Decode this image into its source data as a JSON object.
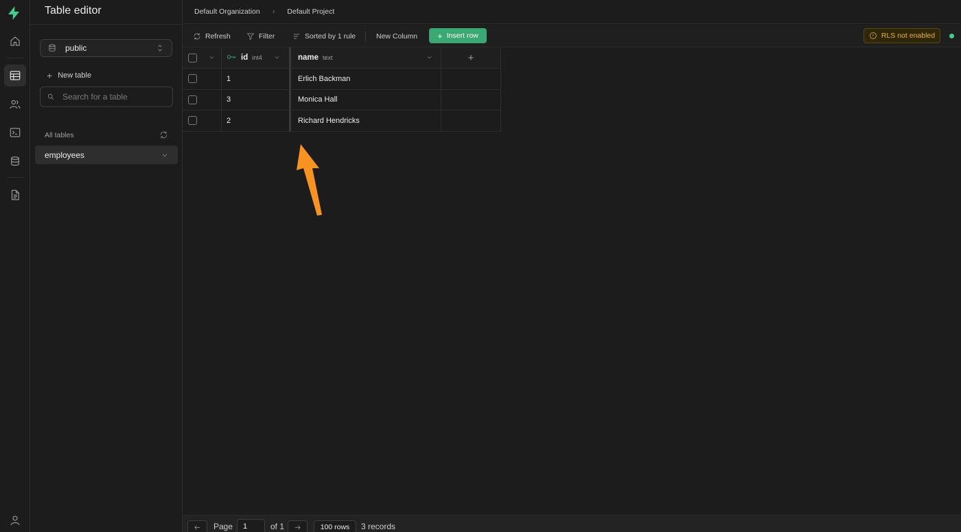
{
  "sidebar": {
    "title": "Table editor",
    "schema": "public",
    "new_table_label": "New table",
    "search_placeholder": "Search for a table",
    "all_tables_label": "All tables",
    "tables": [
      {
        "label": "employees"
      }
    ]
  },
  "breadcrumb": {
    "organization": "Default Organization",
    "project": "Default Project",
    "separator": "›"
  },
  "toolbar": {
    "refresh": "Refresh",
    "filter": "Filter",
    "sort": "Sorted by 1 rule",
    "new_column": "New Column",
    "insert_row": "Insert row",
    "rls": "RLS not enabled"
  },
  "grid": {
    "columns": [
      {
        "name": "id",
        "type": "int4",
        "primary_key": true
      },
      {
        "name": "name",
        "type": "text"
      }
    ],
    "add_column": "+",
    "rows": [
      {
        "id": "1",
        "name": "Erlich Backman"
      },
      {
        "id": "3",
        "name": "Monica Hall"
      },
      {
        "id": "2",
        "name": "Richard Hendricks"
      }
    ]
  },
  "footer": {
    "page_label": "Page",
    "page_value": "1",
    "of_label": "of 1",
    "rows_per_page": "100 rows",
    "records": "3 records"
  },
  "colors": {
    "brand": "#3ecf8e",
    "annotation_arrow": "#f7931e",
    "warning": "#e7b22c"
  },
  "icons": [
    "supabase-logo-icon",
    "home-icon",
    "table-editor-icon",
    "auth-users-icon",
    "sql-editor-icon",
    "database-icon",
    "docs-icon",
    "user-icon"
  ]
}
